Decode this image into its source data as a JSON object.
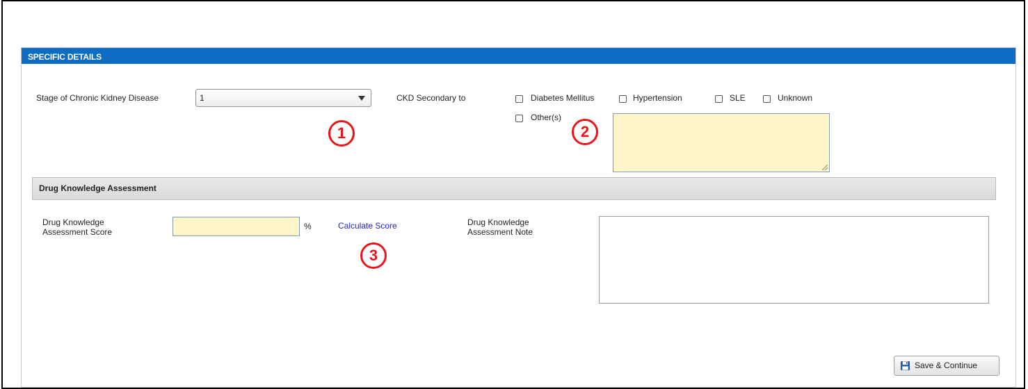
{
  "header": {
    "title": "SPECIFIC DETAILS"
  },
  "stage": {
    "label": "Stage of Chronic Kidney Disease",
    "selected": "1"
  },
  "ckd": {
    "label": "CKD Secondary to",
    "options": [
      "Diabetes Mellitus",
      "Hypertension",
      "SLE",
      "Unknown"
    ],
    "other_label": "Other(s)"
  },
  "callouts": [
    "1",
    "2",
    "3"
  ],
  "drug": {
    "section_title": "Drug Knowledge Assessment",
    "score_label_line1": "Drug Knowledge",
    "score_label_line2": "Assessment Score",
    "score_value": "",
    "percent_symbol": "%",
    "calculate_link": "Calculate Score",
    "note_label_line1": "Drug Knowledge",
    "note_label_line2": "Assessment Note",
    "note_value": ""
  },
  "footer": {
    "save_label": "Save & Continue"
  },
  "colors": {
    "header_blue": "#0e6cc2",
    "input_yellow": "#fff5c9",
    "callout_red": "#e8141a",
    "link_blue": "#1e1ed6"
  }
}
